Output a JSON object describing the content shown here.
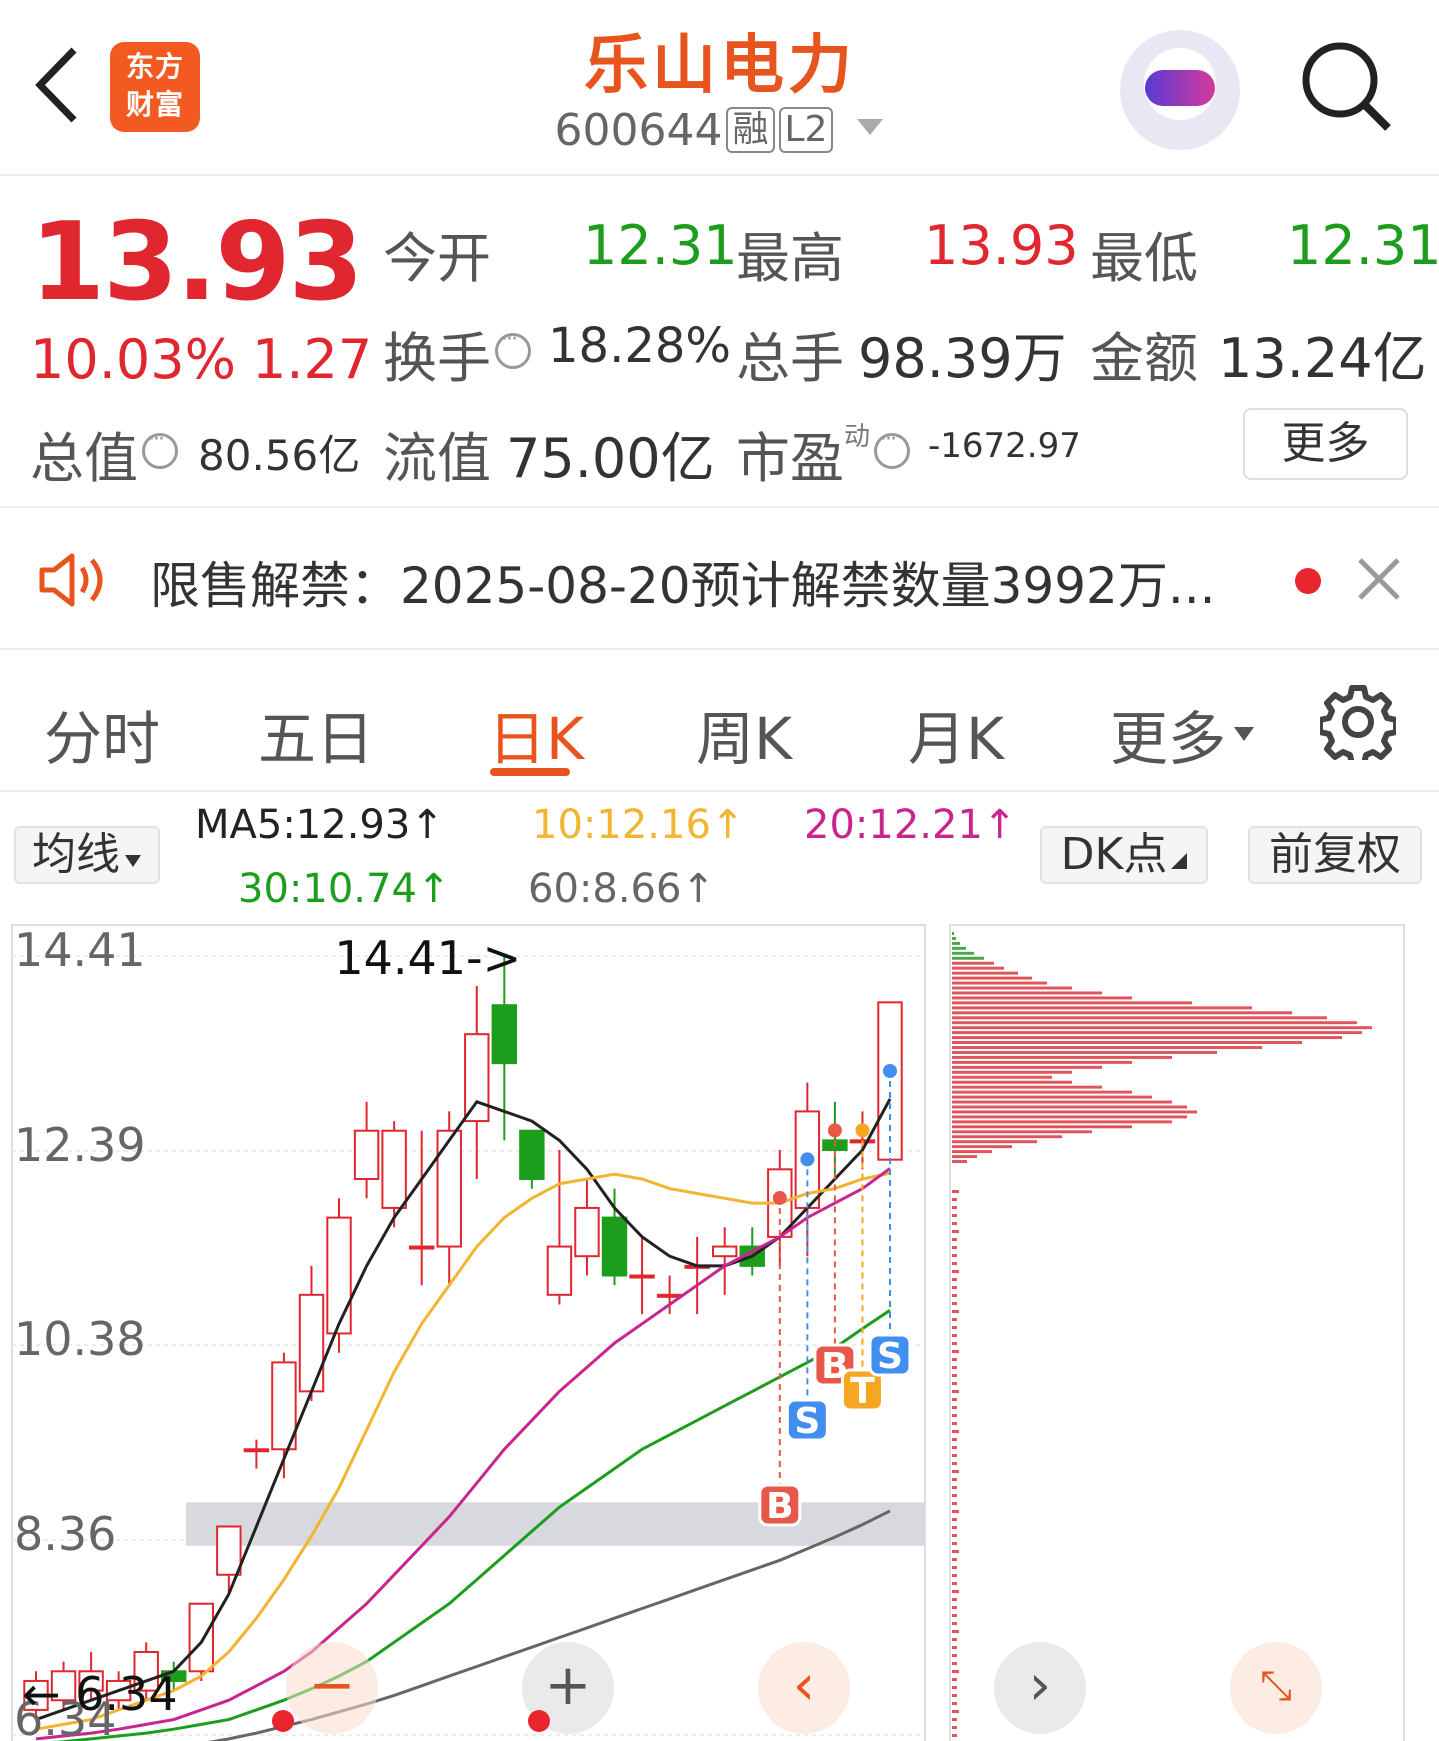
{
  "header": {
    "logo_line1": "东方",
    "logo_line2": "财富",
    "title": "乐山电力",
    "code": "600644",
    "tag_margin": "融",
    "tag_level": "L2"
  },
  "quote": {
    "price": "13.93",
    "change_pct": "10.03%",
    "change": "1.27",
    "open_label": "今开",
    "open": "12.31",
    "high_label": "最高",
    "high": "13.93",
    "low_label": "最低",
    "low": "12.31",
    "turnover_label": "换手",
    "turnover": "18.28%",
    "volume_label": "总手",
    "volume": "98.39万",
    "amount_label": "金额",
    "amount": "13.24亿",
    "mktcap_label": "总值",
    "mktcap": "80.56亿",
    "float_label": "流值",
    "float_cap": "75.00亿",
    "pe_label": "市盈",
    "pe_sup": "动",
    "pe": "-1672.97",
    "more": "更多"
  },
  "notice": {
    "text": "限售解禁：2025-08-20预计解禁数量3992万..."
  },
  "tabs": [
    "分时",
    "五日",
    "日K",
    "周K",
    "月K",
    "更多"
  ],
  "active_tab": "日K",
  "ma": {
    "selector": "均线",
    "ma5": "MA5:12.93↑",
    "ma10": "10:12.16↑",
    "ma20": "20:12.21↑",
    "ma30": "30:10.74↑",
    "ma60": "60:8.66↑",
    "dk_button": "DK点",
    "adjust_button": "前复权"
  },
  "chart_data": {
    "type": "candlestick",
    "y_ticks": [
      "14.41",
      "12.39",
      "10.38",
      "8.36",
      "6.34"
    ],
    "ylim": [
      6.34,
      14.41
    ],
    "max_label": "14.41->",
    "min_label": "6.34",
    "candles": [
      {
        "o": 6.6,
        "c": 6.9,
        "h": 7.0,
        "l": 6.5
      },
      {
        "o": 6.7,
        "c": 7.0,
        "h": 7.1,
        "l": 6.6
      },
      {
        "o": 6.8,
        "c": 7.0,
        "h": 7.2,
        "l": 6.7
      },
      {
        "o": 6.7,
        "c": 6.9,
        "h": 7.0,
        "l": 6.6
      },
      {
        "o": 6.8,
        "c": 7.2,
        "h": 7.3,
        "l": 6.7
      },
      {
        "o": 7.0,
        "c": 6.9,
        "h": 7.1,
        "l": 6.8
      },
      {
        "o": 7.0,
        "c": 7.7,
        "h": 7.7,
        "l": 6.9
      },
      {
        "o": 8.0,
        "c": 8.5,
        "h": 8.5,
        "l": 7.8
      },
      {
        "o": 9.3,
        "c": 9.3,
        "h": 9.4,
        "l": 9.1
      },
      {
        "o": 9.3,
        "c": 10.2,
        "h": 10.3,
        "l": 9.0
      },
      {
        "o": 9.9,
        "c": 10.9,
        "h": 11.2,
        "l": 9.8
      },
      {
        "o": 10.5,
        "c": 11.7,
        "h": 11.9,
        "l": 10.3
      },
      {
        "o": 12.1,
        "c": 12.6,
        "h": 12.9,
        "l": 11.9
      },
      {
        "o": 11.8,
        "c": 12.6,
        "h": 12.7,
        "l": 11.6
      },
      {
        "o": 11.4,
        "c": 11.4,
        "h": 12.6,
        "l": 11.0
      },
      {
        "o": 11.4,
        "c": 12.6,
        "h": 12.8,
        "l": 11.0
      },
      {
        "o": 12.7,
        "c": 13.6,
        "h": 14.1,
        "l": 12.1
      },
      {
        "o": 13.9,
        "c": 13.3,
        "h": 14.41,
        "l": 12.5
      },
      {
        "o": 12.6,
        "c": 12.1,
        "h": 12.6,
        "l": 12.0
      },
      {
        "o": 10.9,
        "c": 11.4,
        "h": 12.4,
        "l": 10.8
      },
      {
        "o": 11.3,
        "c": 11.8,
        "h": 12.1,
        "l": 11.1
      },
      {
        "o": 11.7,
        "c": 11.1,
        "h": 12.0,
        "l": 11.0
      },
      {
        "o": 11.1,
        "c": 11.1,
        "h": 11.5,
        "l": 10.7
      },
      {
        "o": 10.9,
        "c": 10.9,
        "h": 11.1,
        "l": 10.7
      },
      {
        "o": 11.2,
        "c": 11.2,
        "h": 11.5,
        "l": 10.7
      },
      {
        "o": 11.3,
        "c": 11.4,
        "h": 11.6,
        "l": 10.9
      },
      {
        "o": 11.4,
        "c": 11.2,
        "h": 11.6,
        "l": 11.1
      },
      {
        "o": 11.5,
        "c": 12.2,
        "h": 12.4,
        "l": 11.2
      },
      {
        "o": 11.8,
        "c": 12.8,
        "h": 13.1,
        "l": 11.3
      },
      {
        "o": 12.5,
        "c": 12.4,
        "h": 12.9,
        "l": 12.1
      },
      {
        "o": 12.5,
        "c": 12.5,
        "h": 12.8,
        "l": 12.2
      },
      {
        "o": 12.3,
        "c": 13.93,
        "h": 13.93,
        "l": 12.3
      }
    ],
    "series": [
      {
        "name": "MA5",
        "color": "#222222",
        "values": [
          6.5,
          6.6,
          6.7,
          6.8,
          6.9,
          7.0,
          7.3,
          7.8,
          8.5,
          9.2,
          9.9,
          10.6,
          11.2,
          11.7,
          12.1,
          12.5,
          12.9,
          12.8,
          12.7,
          12.5,
          12.2,
          11.8,
          11.5,
          11.3,
          11.2,
          11.2,
          11.3,
          11.5,
          11.8,
          12.1,
          12.4,
          12.93
        ]
      },
      {
        "name": "10",
        "color": "#f2b431",
        "values": [
          6.4,
          6.45,
          6.5,
          6.6,
          6.7,
          6.8,
          6.95,
          7.2,
          7.55,
          7.95,
          8.4,
          8.9,
          9.5,
          10.1,
          10.6,
          11.0,
          11.4,
          11.7,
          11.9,
          12.05,
          12.1,
          12.15,
          12.1,
          12.0,
          11.95,
          11.9,
          11.85,
          11.85,
          11.95,
          12.0,
          12.1,
          12.16
        ]
      },
      {
        "name": "20",
        "color": "#c8258f",
        "values": [
          6.3,
          6.33,
          6.36,
          6.4,
          6.45,
          6.5,
          6.6,
          6.7,
          6.85,
          7.0,
          7.2,
          7.45,
          7.7,
          8.0,
          8.3,
          8.6,
          8.95,
          9.3,
          9.6,
          9.9,
          10.15,
          10.4,
          10.6,
          10.8,
          11.0,
          11.2,
          11.35,
          11.5,
          11.7,
          11.85,
          12.0,
          12.21
        ]
      },
      {
        "name": "30",
        "color": "#1c9d1c",
        "values": [
          6.25,
          6.27,
          6.3,
          6.33,
          6.36,
          6.4,
          6.45,
          6.5,
          6.6,
          6.7,
          6.82,
          6.95,
          7.1,
          7.3,
          7.5,
          7.7,
          7.95,
          8.2,
          8.45,
          8.7,
          8.9,
          9.1,
          9.3,
          9.45,
          9.6,
          9.75,
          9.9,
          10.05,
          10.2,
          10.35,
          10.55,
          10.74
        ]
      },
      {
        "name": "60",
        "color": "#666666",
        "values": [
          6.05,
          6.08,
          6.1,
          6.13,
          6.16,
          6.2,
          6.25,
          6.3,
          6.36,
          6.43,
          6.5,
          6.58,
          6.66,
          6.75,
          6.85,
          6.95,
          7.05,
          7.15,
          7.25,
          7.35,
          7.45,
          7.55,
          7.65,
          7.75,
          7.85,
          7.95,
          8.05,
          8.15,
          8.27,
          8.39,
          8.52,
          8.66
        ]
      }
    ],
    "signals": [
      {
        "label": "B",
        "color": "#e8584a",
        "index": 27
      },
      {
        "label": "S",
        "color": "#3f8ef0",
        "index": 28
      },
      {
        "label": "B",
        "color": "#e8584a",
        "index": 29
      },
      {
        "label": "T",
        "color": "#f5a623",
        "index": 30
      },
      {
        "label": "S",
        "color": "#3f8ef0",
        "index": 31
      }
    ],
    "zone": [
      8.3,
      8.75
    ],
    "volume_profile": [
      2,
      4,
      8,
      14,
      22,
      32,
      42,
      52,
      66,
      80,
      95,
      120,
      150,
      180,
      240,
      300,
      340,
      375,
      405,
      420,
      410,
      390,
      350,
      310,
      265,
      220,
      180,
      150,
      120,
      100,
      120,
      150,
      180,
      200,
      220,
      235,
      245,
      235,
      220,
      180,
      140,
      110,
      85,
      60,
      40,
      25,
      15
    ]
  },
  "controls": [
    "minus",
    "plus",
    "prev",
    "next",
    "expand"
  ]
}
